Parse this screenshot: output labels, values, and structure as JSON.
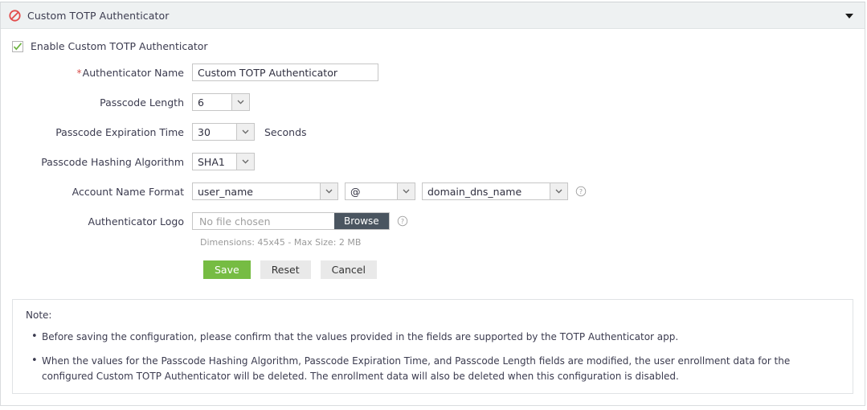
{
  "header": {
    "icon": "prohibited-circle-icon",
    "title": "Custom TOTP Authenticator",
    "collapse_icon": "chevron-down-icon"
  },
  "enable": {
    "label": "Enable Custom TOTP Authenticator",
    "checked": true,
    "check_icon": "checkmark-icon"
  },
  "form": {
    "authenticator_name": {
      "label": "Authenticator Name",
      "required_marker": "*",
      "value": "Custom TOTP Authenticator"
    },
    "passcode_length": {
      "label": "Passcode Length",
      "value": "6"
    },
    "passcode_expiration": {
      "label": "Passcode Expiration Time",
      "value": "30",
      "unit": "Seconds"
    },
    "passcode_hashing": {
      "label": "Passcode Hashing Algorithm",
      "value": "SHA1"
    },
    "account_name_format": {
      "label": "Account Name Format",
      "part1": "user_name",
      "separator": "@",
      "part3": "domain_dns_name",
      "help_icon": "question-mark-icon"
    },
    "authenticator_logo": {
      "label": "Authenticator Logo",
      "file_placeholder": "No file chosen",
      "browse_label": "Browse",
      "help_icon": "question-mark-icon",
      "hint": "Dimensions: 45x45 - Max Size: 2 MB"
    }
  },
  "buttons": {
    "save": "Save",
    "reset": "Reset",
    "cancel": "Cancel"
  },
  "note": {
    "title": "Note:",
    "items": [
      "Before saving the configuration, please confirm that the values provided in the fields are supported by the TOTP Authenticator app.",
      "When the values for the Passcode Hashing Algorithm, Passcode Expiration Time, and Passcode Length fields are modified, the user enrollment data for the configured Custom TOTP Authenticator will be deleted. The enrollment data will also be deleted when this configuration is disabled."
    ]
  },
  "colors": {
    "accent_green": "#76bc43",
    "required_red": "#d9534f",
    "browse_dark": "#4a5560",
    "header_bg": "#eef1f2"
  }
}
